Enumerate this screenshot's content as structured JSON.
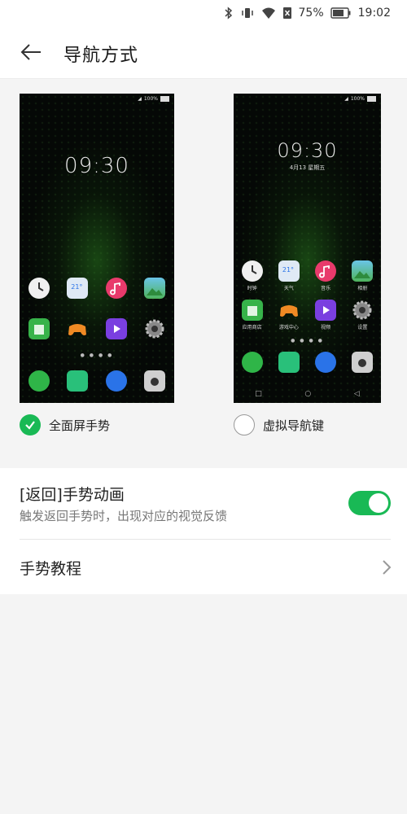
{
  "status": {
    "battery": "75%",
    "time": "19:02",
    "icons": [
      "bluetooth-icon",
      "vibrate-icon",
      "wifi-icon",
      "sim-off-icon",
      "battery-icon"
    ]
  },
  "header": {
    "title": "导航方式",
    "back_icon": "back-arrow-icon"
  },
  "previews": [
    {
      "phone_battery": "100%",
      "clock": "09:30",
      "grid": [
        {
          "name": "clock",
          "color": "#f0f0f0",
          "label": ""
        },
        {
          "name": "weather",
          "color": "#dfe9f5",
          "label": "",
          "text": "21°"
        },
        {
          "name": "music",
          "color": "#e83a6b",
          "label": ""
        },
        {
          "name": "gallery",
          "color": "#4fb35c",
          "label": ""
        },
        {
          "name": "app-store",
          "color": "#37b34a",
          "label": ""
        },
        {
          "name": "game-center",
          "color": "#f08a24",
          "label": ""
        },
        {
          "name": "video",
          "color": "#7a3fe0",
          "label": ""
        },
        {
          "name": "settings",
          "color": "#888888",
          "label": ""
        }
      ],
      "dock": [
        {
          "name": "phone",
          "color": "#2fb548"
        },
        {
          "name": "messages",
          "color": "#29c07a"
        },
        {
          "name": "browser",
          "color": "#2a73e8"
        },
        {
          "name": "camera",
          "color": "#cfcfcf"
        }
      ],
      "option_label": "全面屏手势",
      "selected": true
    },
    {
      "phone_battery": "100%",
      "clock": "09:30",
      "date": "4月13 星期五",
      "grid": [
        {
          "name": "clock",
          "color": "#f0f0f0",
          "label": "时钟"
        },
        {
          "name": "weather",
          "color": "#dfe9f5",
          "label": "天气",
          "text": "21°"
        },
        {
          "name": "music",
          "color": "#e83a6b",
          "label": "音乐"
        },
        {
          "name": "gallery",
          "color": "#4fb35c",
          "label": "相册"
        },
        {
          "name": "app-store",
          "color": "#37b34a",
          "label": "应用商店"
        },
        {
          "name": "game-center",
          "color": "#f08a24",
          "label": "游戏中心"
        },
        {
          "name": "video",
          "color": "#7a3fe0",
          "label": "视频"
        },
        {
          "name": "settings",
          "color": "#888888",
          "label": "设置"
        }
      ],
      "dock": [
        {
          "name": "phone",
          "color": "#2fb548"
        },
        {
          "name": "messages",
          "color": "#29c07a"
        },
        {
          "name": "browser",
          "color": "#2a73e8"
        },
        {
          "name": "camera",
          "color": "#cfcfcf"
        }
      ],
      "navkeys": [
        "□",
        "○",
        "◁"
      ],
      "option_label": "虚拟导航键",
      "selected": false
    }
  ],
  "settings": {
    "gesture_animation": {
      "title": "[返回]手势动画",
      "subtitle": "触发返回手势时，出现对应的视觉反馈",
      "enabled": true
    },
    "tutorial": {
      "title": "手势教程"
    }
  },
  "colors": {
    "accent": "#19b955",
    "background": "#f4f4f4"
  }
}
